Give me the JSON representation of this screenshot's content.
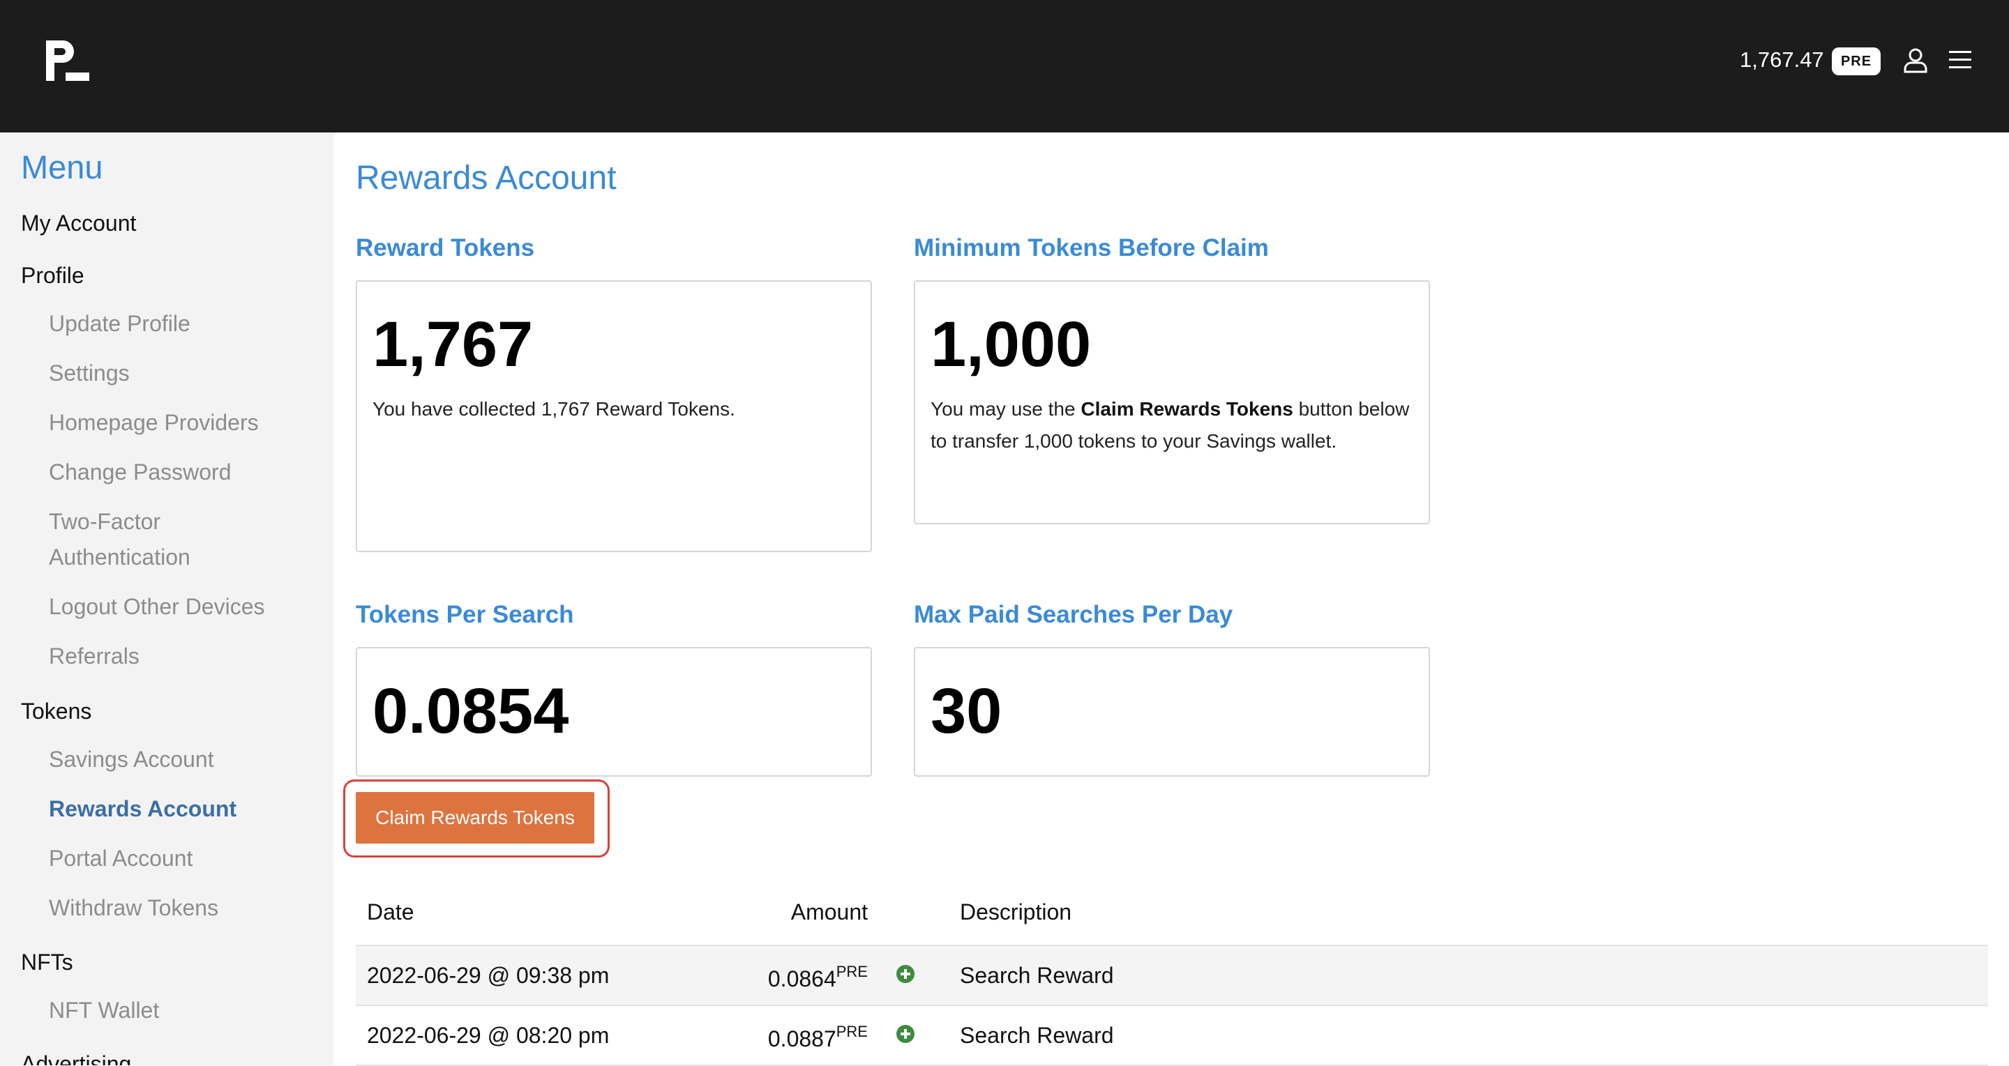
{
  "header": {
    "balance": "1,767.47",
    "currency_badge": "PRE",
    "logo_icon": "brand-logo-icon",
    "user_icon": "user-icon",
    "menu_icon": "hamburger-menu-icon"
  },
  "sidebar": {
    "title": "Menu",
    "my_account": "My Account",
    "profile": "Profile",
    "profile_items": [
      "Update Profile",
      "Settings",
      "Homepage Providers",
      "Change Password",
      "Two-Factor Authentication",
      "Logout Other Devices",
      "Referrals"
    ],
    "tokens": "Tokens",
    "tokens_items": [
      "Savings Account",
      "Rewards Account",
      "Portal Account",
      "Withdraw Tokens"
    ],
    "nfts": "NFTs",
    "nfts_items": [
      "NFT Wallet"
    ],
    "advertising": "Advertising"
  },
  "main": {
    "title": "Rewards Account",
    "reward_tokens": {
      "label": "Reward Tokens",
      "value": "1,767",
      "desc": "You have collected 1,767 Reward Tokens."
    },
    "min_tokens": {
      "label": "Minimum Tokens Before Claim",
      "value": "1,000",
      "desc_before": "You may use the ",
      "desc_bold": "Claim Rewards Tokens",
      "desc_after": " button below to transfer 1,000 tokens to your Savings wallet."
    },
    "tokens_per_search": {
      "label": "Tokens Per Search",
      "value": "0.0854"
    },
    "max_searches": {
      "label": "Max Paid Searches Per Day",
      "value": "30"
    },
    "claim_button": "Claim Rewards Tokens"
  },
  "table": {
    "headers": {
      "date": "Date",
      "amount": "Amount",
      "description": "Description"
    },
    "rows": [
      {
        "date": "2022-06-29 @ 09:38 pm",
        "amount": "0.0864",
        "unit": "PRE",
        "description": "Search Reward"
      },
      {
        "date": "2022-06-29 @ 08:20 pm",
        "amount": "0.0887",
        "unit": "PRE",
        "description": "Search Reward"
      }
    ],
    "status_icon": "plus-circle-icon"
  },
  "colors": {
    "accent": "#3a8ad6",
    "header_bg": "#1c1c1c",
    "claim_button": "#dd7440",
    "highlight_ring": "#d9413a",
    "plus_icon": "#3f8b3f"
  }
}
